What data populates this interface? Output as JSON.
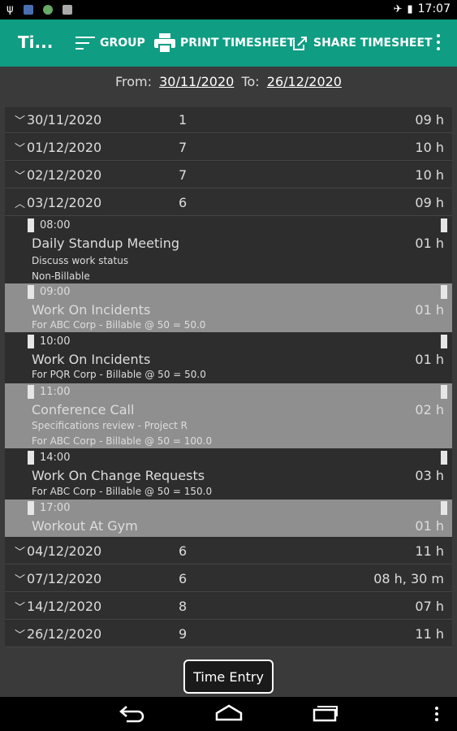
{
  "status_bar": {
    "time": "17:07",
    "icons": [
      "usb-icon",
      "notification-icon",
      "app-icon",
      "sd-card-icon",
      "airplane-icon",
      "battery-icon"
    ]
  },
  "action_bar": {
    "title": "Ti...",
    "group_label": "GROUP",
    "print_label": "PRINT TIMESHEET",
    "share_label": "SHARE TIMESHEET",
    "accent": "#0f9d83"
  },
  "date_range": {
    "from_label": "From:",
    "from": "30/11/2020",
    "to_label": "To:",
    "to": "26/12/2020"
  },
  "days_before": [
    {
      "date": "30/11/2020",
      "count": "1",
      "hours": "09 h",
      "expanded": false
    },
    {
      "date": "01/12/2020",
      "count": "7",
      "hours": "10 h",
      "expanded": false
    },
    {
      "date": "02/12/2020",
      "count": "7",
      "hours": "10 h",
      "expanded": false
    },
    {
      "date": "03/12/2020",
      "count": "6",
      "hours": "09 h",
      "expanded": true
    }
  ],
  "entries": [
    {
      "time": "08:00",
      "title": "Daily Standup Meeting",
      "duration": "01 h",
      "lines": [
        "Discuss work status",
        "Non-Billable"
      ]
    },
    {
      "time": "09:00",
      "title": "Work On Incidents",
      "duration": "01 h",
      "lines": [
        "For ABC Corp - Billable @ 50 = 50.0"
      ]
    },
    {
      "time": "10:00",
      "title": "Work On Incidents",
      "duration": "01 h",
      "lines": [
        "For PQR Corp - Billable @ 50 = 50.0"
      ]
    },
    {
      "time": "11:00",
      "title": "Conference Call",
      "duration": "02 h",
      "lines": [
        "Specifications review - Project R",
        "For ABC Corp - Billable @ 50 = 100.0"
      ]
    },
    {
      "time": "14:00",
      "title": "Work On Change Requests",
      "duration": "03 h",
      "lines": [
        "For ABC Corp - Billable @ 50 = 150.0"
      ]
    },
    {
      "time": "17:00",
      "title": "Workout At Gym",
      "duration": "01 h",
      "lines": []
    }
  ],
  "days_after": [
    {
      "date": "04/12/2020",
      "count": "6",
      "hours": "11 h"
    },
    {
      "date": "07/12/2020",
      "count": "6",
      "hours": "08 h, 30 m"
    },
    {
      "date": "14/12/2020",
      "count": "8",
      "hours": "07 h"
    },
    {
      "date": "26/12/2020",
      "count": "9",
      "hours": "11 h"
    }
  ],
  "bottom": {
    "button_label": "Time Entry"
  }
}
